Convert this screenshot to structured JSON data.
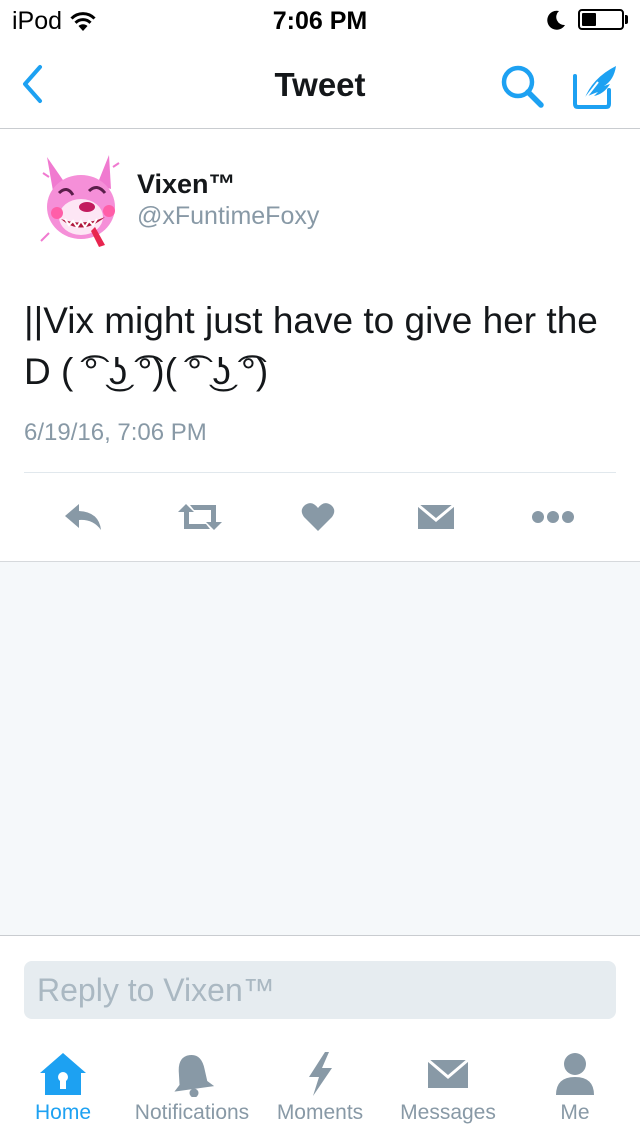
{
  "status_bar": {
    "carrier": "iPod",
    "time": "7:06 PM",
    "battery_level": 0.38
  },
  "nav": {
    "title": "Tweet"
  },
  "tweet": {
    "author_name": "Vixen™",
    "author_handle": "@xFuntimeFoxy",
    "text": "||Vix might just have to give her the D ( ͡° ͜ʖ ͡°)( ͡° ͜ʖ ͡°)",
    "timestamp": "6/19/16, 7:06 PM",
    "actions": [
      "reply-icon",
      "retweet-icon",
      "like-icon",
      "direct-message-icon",
      "more-icon"
    ]
  },
  "reply": {
    "placeholder": "Reply to Vixen™"
  },
  "tabs": [
    {
      "label": "Home",
      "icon": "home-icon",
      "active": true
    },
    {
      "label": "Notifications",
      "icon": "bell-icon",
      "active": false
    },
    {
      "label": "Moments",
      "icon": "lightning-icon",
      "active": false
    },
    {
      "label": "Messages",
      "icon": "envelope-icon",
      "active": false
    },
    {
      "label": "Me",
      "icon": "person-icon",
      "active": false
    }
  ],
  "colors": {
    "accent": "#1da1f2",
    "icon_gray": "#8899a6",
    "background_gray": "#f5f8fa"
  }
}
